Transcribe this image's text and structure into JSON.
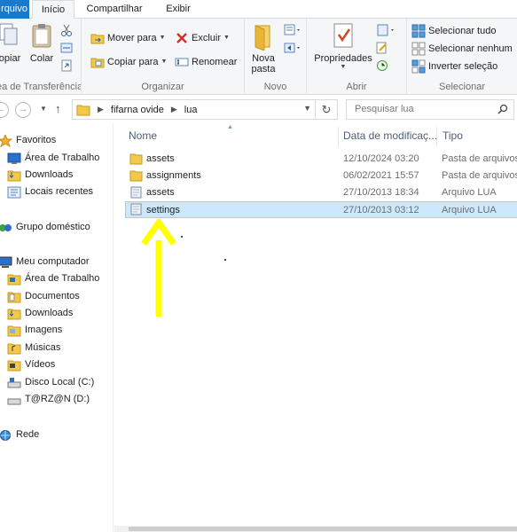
{
  "tabs": {
    "file": "rquivo",
    "home": "Início",
    "share": "Compartilhar",
    "view": "Exibir"
  },
  "ribbon": {
    "clipboard": {
      "label": "ea de Transferência",
      "copy": "opiar",
      "paste": "Colar"
    },
    "organize": {
      "label": "Organizar",
      "move_to": "Mover para",
      "copy_to": "Copiar para",
      "delete": "Excluir",
      "rename": "Renomear"
    },
    "new": {
      "label": "Novo",
      "new_folder_line1": "Nova",
      "new_folder_line2": "pasta"
    },
    "open": {
      "label": "Abrir",
      "properties": "Propriedades"
    },
    "select": {
      "label": "Selecionar",
      "select_all": "Selecionar tudo",
      "select_none": "Selecionar nenhum",
      "invert": "Inverter seleção"
    }
  },
  "address": {
    "path": [
      "fifarna ovide",
      "lua"
    ],
    "search_placeholder": "Pesquisar lua"
  },
  "navpane": {
    "favorites": "Favoritos",
    "desktop": "Área de Trabalho",
    "downloads": "Downloads",
    "recent": "Locais recentes",
    "homegroup": "Grupo doméstico",
    "computer": "Meu computador",
    "pc_desktop": "Área de Trabalho",
    "documents": "Documentos",
    "pc_downloads": "Downloads",
    "images": "Imagens",
    "music": "Músicas",
    "videos": "Vídeos",
    "local_disk": "Disco Local (C:)",
    "drive_d": "T@RZ@N (D:)",
    "network": "Rede"
  },
  "columns": {
    "name": "Nome",
    "date": "Data de modificaç...",
    "type": "Tipo"
  },
  "files": [
    {
      "name": "assets",
      "date": "12/10/2024 03:20",
      "type": "Pasta de arquivos",
      "kind": "folder"
    },
    {
      "name": "assignments",
      "date": "06/02/2021 15:57",
      "type": "Pasta de arquivos",
      "kind": "folder"
    },
    {
      "name": "assets",
      "date": "27/10/2013 18:34",
      "type": "Arquivo LUA",
      "kind": "file"
    },
    {
      "name": "settings",
      "date": "27/10/2013 03:12",
      "type": "Arquivo LUA",
      "kind": "file",
      "selected": true
    }
  ],
  "colors": {
    "accent": "#1979ca",
    "selection": "#cce8ff",
    "annotation_arrow": "#ffff00"
  }
}
